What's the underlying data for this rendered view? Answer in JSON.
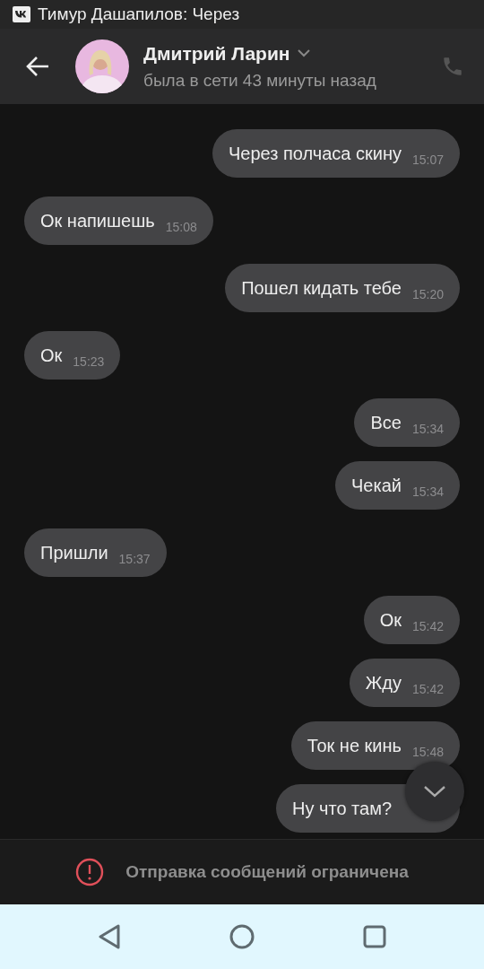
{
  "status_bar": {
    "notification": "Тимур Дашапилов: Через"
  },
  "header": {
    "name": "Дмитрий Ларин",
    "last_seen": "была в сети 43 минуты назад"
  },
  "messages": [
    {
      "kind": "out",
      "text": "Через полчаса скину",
      "time": "15:07"
    },
    {
      "kind": "in",
      "text": "Ок напишешь",
      "time": "15:08"
    },
    {
      "kind": "out",
      "text": "Пошел кидать тебе",
      "time": "15:20"
    },
    {
      "kind": "in",
      "text": "Ок",
      "time": "15:23"
    },
    {
      "kind": "out",
      "text": "Все",
      "time": "15:34"
    },
    {
      "kind": "out",
      "text": "Чекай",
      "time": "15:34"
    },
    {
      "kind": "in",
      "text": "Пришли",
      "time": "15:37"
    },
    {
      "kind": "out",
      "text": "Ок",
      "time": "15:42"
    },
    {
      "kind": "out",
      "text": "Жду",
      "time": "15:42"
    },
    {
      "kind": "out",
      "text": "Ток не кинь",
      "time": "15:48"
    },
    {
      "kind": "out",
      "text": "Ну что там?"
    }
  ],
  "footer": {
    "notice": "Отправка сообщений ограничена"
  }
}
